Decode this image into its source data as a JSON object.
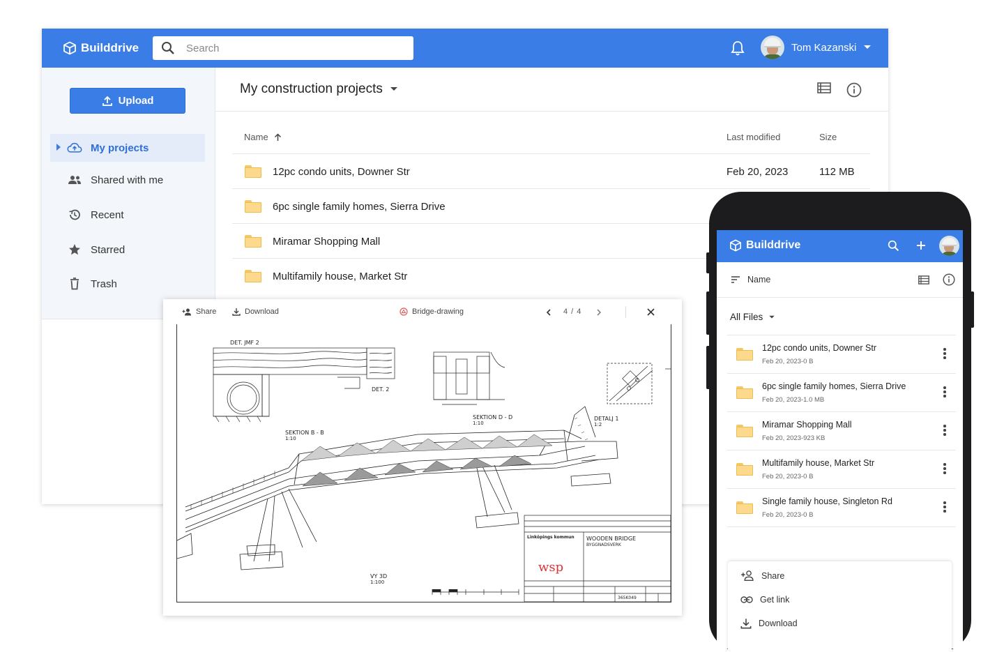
{
  "desktop": {
    "brand": "Builddrive",
    "search_placeholder": "Search",
    "user_name": "Tom Kazanski",
    "upload_label": "Upload",
    "nav": [
      {
        "label": "My projects",
        "icon": "cloud-upload-icon",
        "active": true
      },
      {
        "label": "Shared with me",
        "icon": "people-icon"
      },
      {
        "label": "Recent",
        "icon": "history-icon"
      },
      {
        "label": "Starred",
        "icon": "star-icon"
      },
      {
        "label": "Trash",
        "icon": "trash-icon"
      }
    ],
    "folder_title": "My construction projects",
    "columns": {
      "name": "Name",
      "modified": "Last modified",
      "size": "Size"
    },
    "rows": [
      {
        "name": "12pc condo units, Downer Str",
        "modified": "Feb 20, 2023",
        "size": "112 MB"
      },
      {
        "name": "6pc single family homes, Sierra Drive",
        "modified": "",
        "size": ""
      },
      {
        "name": "Miramar Shopping Mall",
        "modified": "",
        "size": ""
      },
      {
        "name": "Multifamily house, Market Str",
        "modified": "",
        "size": ""
      }
    ]
  },
  "viewer": {
    "share_label": "Share",
    "download_label": "Download",
    "file_name": "Bridge-drawing",
    "page_current": "4",
    "page_sep": "/",
    "page_total": "4",
    "drawing_labels": {
      "det_jmf": "DET. JMF 2",
      "det2": "DET. 2",
      "sektion_bb": "SEKTION B - B",
      "scale_bb": "1:10",
      "sektion_dd": "SEKTION D - D",
      "scale_dd": "1:10",
      "detalj": "DETALJ 1",
      "scale_detalj": "1:2",
      "vy3d": "VY 3D",
      "scale_vy": "1:100",
      "title1": "WOODEN BRIDGE",
      "title2": "BYGGNADSVERK",
      "company": "wsp",
      "municipality": "Linköpings kommun",
      "drawing_no": "365K049"
    }
  },
  "mobile": {
    "brand": "Builddrive",
    "sort_label": "Name",
    "filter_label": "All Files",
    "files": [
      {
        "name": "12pc condo units, Downer Str",
        "meta": "Feb 20, 2023-0 B"
      },
      {
        "name": "6pc single family homes, Sierra Drive",
        "meta": "Feb 20, 2023-1.0 MB"
      },
      {
        "name": "Miramar Shopping Mall",
        "meta": "Feb 20, 2023-923 KB"
      },
      {
        "name": "Multifamily house, Market Str",
        "meta": "Feb 20, 2023-0 B"
      },
      {
        "name": "Single family house, Singleton Rd",
        "meta": "Feb 20, 2023-0 B"
      }
    ],
    "sheet": {
      "share": "Share",
      "get_link": "Get link",
      "download": "Download"
    }
  },
  "colors": {
    "accent": "#3b7de6",
    "folder": "#fcd98c",
    "sidebar_bg": "#f3f6fa",
    "phone_frame": "#1c1c1e"
  }
}
